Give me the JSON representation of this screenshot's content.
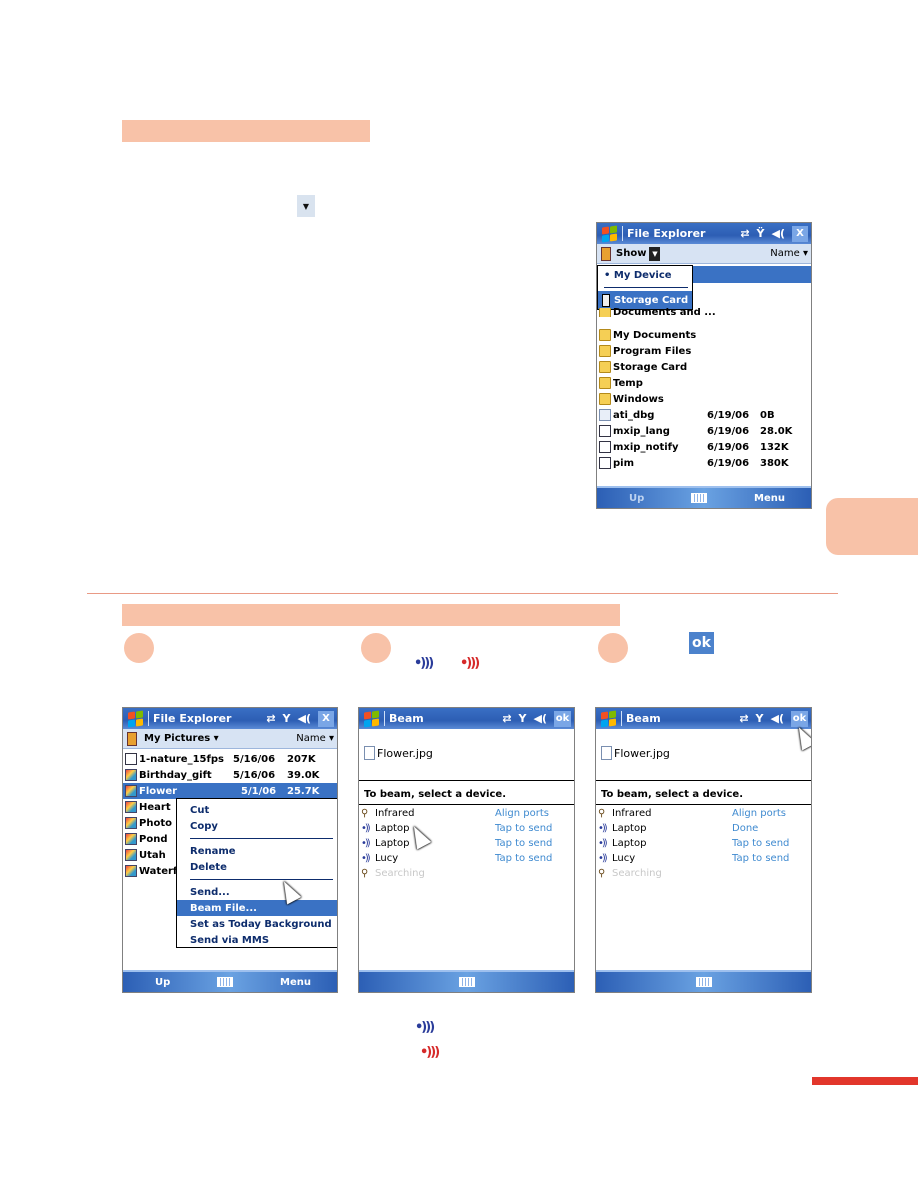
{
  "page": {
    "colors": {
      "accent_peach": "#f8c2a8",
      "accent_red": "#e2362b",
      "pocketpc_blue": "#3a72c4"
    },
    "dropdown_arrow_icon": "triangle-down",
    "ok_button_sample": "ok",
    "beam_icons": {
      "blue": "•)))",
      "red": "•)))"
    }
  },
  "screen_explorer_top": {
    "title": "File Explorer",
    "status_icons": [
      "sync-icon",
      "signal-off-icon",
      "volume-icon",
      "close-icon"
    ],
    "close_label": "X",
    "show_label": "Show",
    "sort_label": "Name",
    "dropdown": [
      {
        "label": "• My Device",
        "selected": false
      },
      {
        "label": "Storage Card",
        "selected": true
      }
    ],
    "rows": [
      {
        "name": "Documents and ...",
        "type": "folder",
        "date": "",
        "size": ""
      },
      {
        "name": "My Documents",
        "type": "folder",
        "date": "",
        "size": ""
      },
      {
        "name": "Program Files",
        "type": "folder",
        "date": "",
        "size": ""
      },
      {
        "name": "Storage Card",
        "type": "storage",
        "date": "",
        "size": ""
      },
      {
        "name": "Temp",
        "type": "folder",
        "date": "",
        "size": ""
      },
      {
        "name": "Windows",
        "type": "folder",
        "date": "",
        "size": ""
      },
      {
        "name": "ati_dbg",
        "type": "doc",
        "date": "6/19/06",
        "size": "0B"
      },
      {
        "name": "mxip_lang",
        "type": "app",
        "date": "6/19/06",
        "size": "28.0K"
      },
      {
        "name": "mxip_notify",
        "type": "app",
        "date": "6/19/06",
        "size": "132K"
      },
      {
        "name": "pim",
        "type": "app",
        "date": "6/19/06",
        "size": "380K"
      }
    ],
    "bottom": {
      "left": "Up",
      "right": "Menu"
    }
  },
  "screen_explorer_step1": {
    "title": "File Explorer",
    "close_label": "X",
    "folder_label": "My Pictures",
    "sort_label": "Name",
    "rows": [
      {
        "name": "1-nature_15fps",
        "date": "5/16/06",
        "size": "207K",
        "selected": false
      },
      {
        "name": "Birthday_gift",
        "date": "5/16/06",
        "size": "39.0K",
        "selected": false
      },
      {
        "name": "Flower",
        "date": "5/1/06",
        "size": "25.7K",
        "selected": true
      },
      {
        "name": "Heart",
        "date": "",
        "size": "",
        "selected": false
      },
      {
        "name": "Photo",
        "date": "",
        "size": "",
        "selected": false
      },
      {
        "name": "Pond",
        "date": "",
        "size": "",
        "selected": false
      },
      {
        "name": "Utah",
        "date": "",
        "size": "",
        "selected": false
      },
      {
        "name": "Waterf",
        "date": "",
        "size": "",
        "selected": false
      }
    ],
    "context_menu": {
      "group1": [
        "Cut",
        "Copy"
      ],
      "group2": [
        "Rename",
        "Delete"
      ],
      "group3": [
        "Send...",
        "Beam File...",
        "Set as Today Background",
        "Send via MMS"
      ],
      "selected": "Beam File..."
    },
    "bottom": {
      "left": "Up",
      "right": "Menu"
    }
  },
  "screen_beam_step2": {
    "title": "Beam",
    "ok_label": "ok",
    "file": "Flower.jpg",
    "prompt": "To beam, select a device.",
    "devices": [
      {
        "name": "Infrared",
        "icon": "search-icon",
        "action": "Align ports"
      },
      {
        "name": "Laptop",
        "icon": "beam-icon",
        "action": "Tap to send"
      },
      {
        "name": "Laptop",
        "icon": "beam-icon",
        "action": "Tap to send"
      },
      {
        "name": "Lucy",
        "icon": "beam-icon",
        "action": "Tap to send"
      },
      {
        "name": "Searching",
        "icon": "search-icon",
        "action": ""
      }
    ]
  },
  "screen_beam_step3": {
    "title": "Beam",
    "ok_label": "ok",
    "file": "Flower.jpg",
    "prompt": "To beam, select a device.",
    "devices": [
      {
        "name": "Infrared",
        "icon": "search-icon",
        "action": "Align ports"
      },
      {
        "name": "Laptop",
        "icon": "beam-icon",
        "action": "Done"
      },
      {
        "name": "Laptop",
        "icon": "beam-icon",
        "action": "Tap to send"
      },
      {
        "name": "Lucy",
        "icon": "beam-icon",
        "action": "Tap to send"
      },
      {
        "name": "Searching",
        "icon": "search-icon",
        "action": ""
      }
    ]
  }
}
